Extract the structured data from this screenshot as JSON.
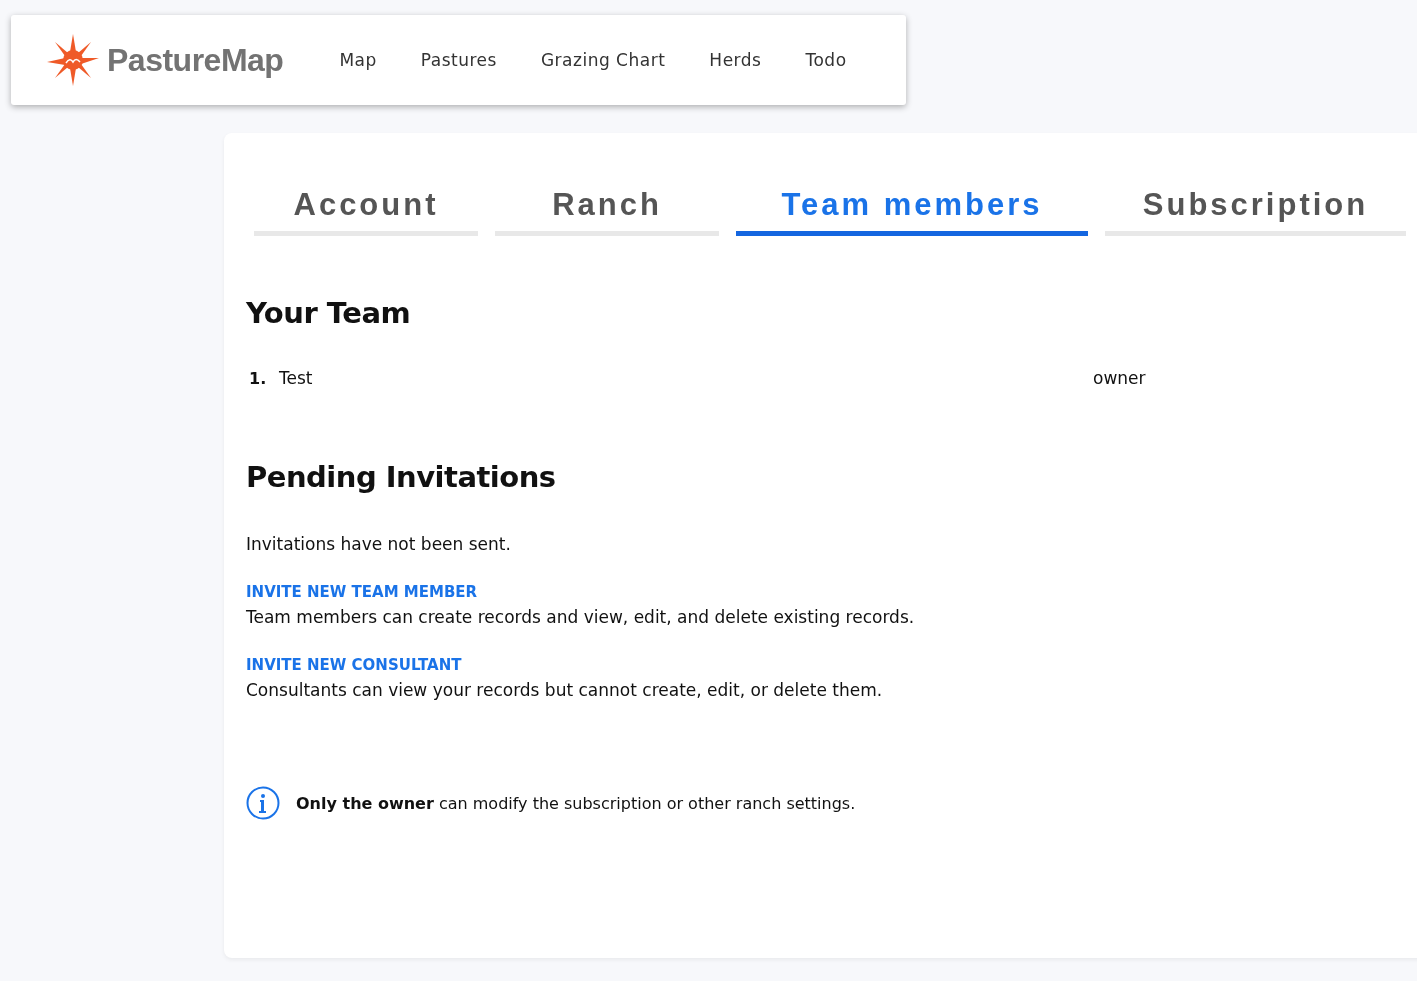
{
  "nav": {
    "logo_text": "PastureMap",
    "links": [
      {
        "label": "Map"
      },
      {
        "label": "Pastures"
      },
      {
        "label": "Grazing Chart"
      },
      {
        "label": "Herds"
      },
      {
        "label": "Todo"
      }
    ]
  },
  "tabs": [
    {
      "label": "Account",
      "selected": false
    },
    {
      "label": "Ranch",
      "selected": false
    },
    {
      "label": "Team members",
      "selected": true
    },
    {
      "label": "Subscription",
      "selected": false
    }
  ],
  "team": {
    "heading": "Your Team",
    "members": [
      {
        "number": "1.",
        "name": "Test",
        "role": "owner"
      }
    ]
  },
  "invitations": {
    "heading": "Pending Invitations",
    "status": "Invitations have not been sent."
  },
  "invites": [
    {
      "link": "INVITE NEW TEAM MEMBER",
      "description": "Team members can create records and view, edit, and delete existing records."
    },
    {
      "link": "INVITE NEW CONSULTANT",
      "description": "Consultants can view your records but cannot create, edit, or delete them."
    }
  ],
  "note": "**Only the owner** can modify the subscription or other ranch settings."
}
